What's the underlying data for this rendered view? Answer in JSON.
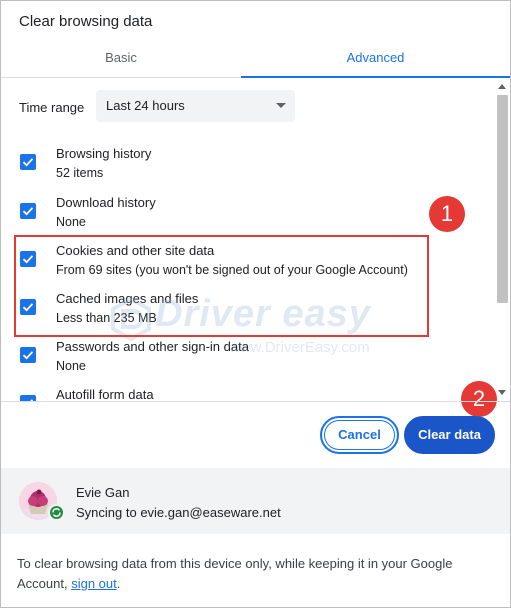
{
  "dialog": {
    "title": "Clear browsing data"
  },
  "tabs": [
    {
      "label": "Basic",
      "active": false
    },
    {
      "label": "Advanced",
      "active": true
    }
  ],
  "time_range": {
    "label": "Time range",
    "selected": "Last 24 hours"
  },
  "items": [
    {
      "title": "Browsing history",
      "subtitle": "52 items",
      "checked": true
    },
    {
      "title": "Download history",
      "subtitle": "None",
      "checked": true
    },
    {
      "title": "Cookies and other site data",
      "subtitle": "From 69 sites (you won't be signed out of your Google Account)",
      "checked": true
    },
    {
      "title": "Cached images and files",
      "subtitle": "Less than 235 MB",
      "checked": true
    },
    {
      "title": "Passwords and other sign-in data",
      "subtitle": "None",
      "checked": true
    },
    {
      "title": "Autofill form data",
      "subtitle": "",
      "checked": true
    }
  ],
  "annotations": {
    "badge_1": "1",
    "badge_2": "2"
  },
  "watermark": {
    "brand": "Driver easy",
    "url": "www.DriverEasy.com"
  },
  "buttons": {
    "cancel": "Cancel",
    "clear": "Clear data"
  },
  "account": {
    "name": "Evie Gan",
    "sync_text": "Syncing to evie.gan@easeware.net"
  },
  "footer_note": {
    "text": "To clear browsing data from this device only, while keeping it in your Google Account, ",
    "link": "sign out",
    "end": "."
  },
  "colors": {
    "accent": "#1a73e8",
    "primary_button": "#1a56c8",
    "annotation_red": "#e53935"
  }
}
